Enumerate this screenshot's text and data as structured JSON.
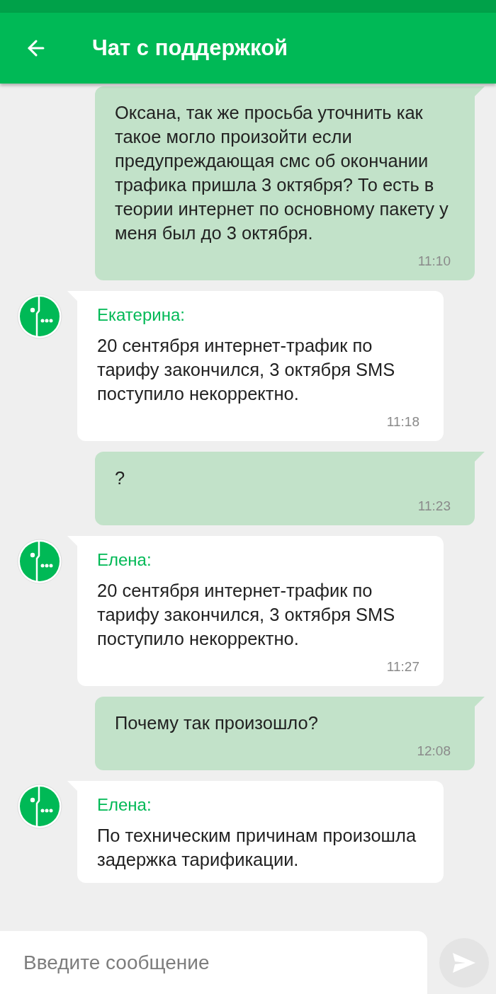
{
  "header": {
    "title": "Чат с поддержкой"
  },
  "messages": [
    {
      "kind": "outgoing",
      "text": "Оксана, так же просьба уточнить как такое могло произойти если предупреждающая смс об окончании трафика пришла 3 октября? То есть в теории интернет по основному пакету у меня был до 3 октября.",
      "time": "11:10"
    },
    {
      "kind": "incoming",
      "author": "Екатерина:",
      "text": "20 сентября интернет-трафик по тарифу закончился, 3 октября SMS поступило некорректно.",
      "time": "11:18"
    },
    {
      "kind": "outgoing",
      "text": "?",
      "time": "11:23"
    },
    {
      "kind": "incoming",
      "author": "Елена:",
      "text": "20 сентября интернет-трафик по тарифу закончился, 3 октября SMS поступило некорректно.",
      "time": "11:27"
    },
    {
      "kind": "outgoing",
      "text": "Почему так произошло?",
      "time": "12:08"
    },
    {
      "kind": "incoming",
      "author": "Елена:",
      "text": "По техническим причинам произошла задержка тарификации."
    }
  ],
  "composer": {
    "placeholder": "Введите сообщение",
    "send_disabled": true
  }
}
